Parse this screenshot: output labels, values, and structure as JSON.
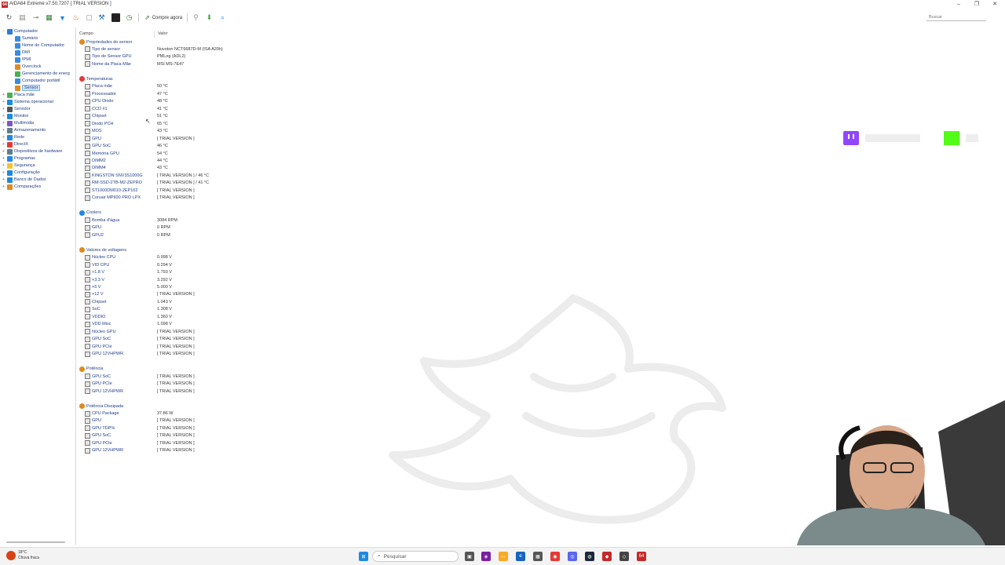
{
  "window": {
    "title": "AIDA64 Extreme v7.50.7207  [ TRIAL VERSION ]",
    "app_icon": "64"
  },
  "toolbar": {
    "buy_label": "Compre agora",
    "search_placeholder": "Buscar"
  },
  "sidebar": {
    "items": [
      {
        "label": "Computador",
        "color": "#2e7bd6"
      },
      {
        "label": "Sumário",
        "color": "#3a8be0"
      },
      {
        "label": "Nome do Computador",
        "color": "#3a8be0"
      },
      {
        "label": "DMI",
        "color": "#3a8be0"
      },
      {
        "label": "IPMI",
        "color": "#3a8be0"
      },
      {
        "label": "Overclock",
        "color": "#e08a1e"
      },
      {
        "label": "Gerenciamento de energ",
        "color": "#4caf50"
      },
      {
        "label": "Computador portátil",
        "color": "#3a8be0"
      },
      {
        "label": "Sensor",
        "color": "#e08a1e"
      },
      {
        "label": "Placa mãe",
        "color": "#4caf50"
      },
      {
        "label": "Sistema operacional",
        "color": "#1e88e5"
      },
      {
        "label": "Servidor",
        "color": "#555555"
      },
      {
        "label": "Monitor",
        "color": "#1e88e5"
      },
      {
        "label": "Multimídia",
        "color": "#7e57c2"
      },
      {
        "label": "Armazenamento",
        "color": "#607d8b"
      },
      {
        "label": "Rede",
        "color": "#1e88e5"
      },
      {
        "label": "DirectX",
        "color": "#e53935"
      },
      {
        "label": "Dispositivos de hardware",
        "color": "#607d8b"
      },
      {
        "label": "Programas",
        "color": "#1e88e5"
      },
      {
        "label": "Segurança",
        "color": "#fbc02d"
      },
      {
        "label": "Configuração",
        "color": "#1e88e5"
      },
      {
        "label": "Banco de Dados",
        "color": "#1e88e5"
      },
      {
        "label": "Comparações",
        "color": "#e08a1e"
      }
    ]
  },
  "main": {
    "col_field": "Campo",
    "col_value": "Valor",
    "rows": [
      {
        "type": "section",
        "label": "Propriedades do sensor",
        "color": "#e08a1e"
      },
      {
        "type": "row",
        "field": "Tipo de sensor",
        "value": "Nuvoton NCT6687D-M  (ISA A20h)"
      },
      {
        "type": "row",
        "field": "Tipo de Sensor GPU",
        "value": "PMLog  (ADL2)"
      },
      {
        "type": "row",
        "field": "Nome da Placa Mãe",
        "value": "MSI MS-7E47"
      },
      {
        "type": "gap"
      },
      {
        "type": "section",
        "label": "Temperaturas",
        "color": "#e53935"
      },
      {
        "type": "row",
        "field": "Placa mãe",
        "value": "50 °C"
      },
      {
        "type": "row",
        "field": "Processador",
        "value": "47 °C"
      },
      {
        "type": "row",
        "field": "CPU Diodo",
        "value": "48 °C"
      },
      {
        "type": "row",
        "field": "CCD #1",
        "value": "41 °C"
      },
      {
        "type": "row",
        "field": "Chipset",
        "value": "51 °C"
      },
      {
        "type": "row",
        "field": "Diodo PCH",
        "value": "65 °C"
      },
      {
        "type": "row",
        "field": "MOS",
        "value": "43 °C"
      },
      {
        "type": "row",
        "field": "GPU",
        "value": "[ TRIAL VERSION ]"
      },
      {
        "type": "row",
        "field": "GPU SoC",
        "value": "46 °C"
      },
      {
        "type": "row",
        "field": "Memória GPU",
        "value": "54 °C"
      },
      {
        "type": "row",
        "field": "DIMM2",
        "value": "44 °C"
      },
      {
        "type": "row",
        "field": "DIMM4",
        "value": "43 °C"
      },
      {
        "type": "row",
        "field": "KINGSTON SNV3S1000G",
        "value": "[ TRIAL VERSION ] / 46 °C"
      },
      {
        "type": "row",
        "field": "RM-SSD-2TB-M2-ZEPRO",
        "value": "[ TRIAL VERSION ] / 41 °C"
      },
      {
        "type": "row",
        "field": "ST1000DM010-2EP102",
        "value": "[ TRIAL VERSION ]"
      },
      {
        "type": "row",
        "field": "Corsair MP600 PRO LPX",
        "value": "[ TRIAL VERSION ]"
      },
      {
        "type": "gap"
      },
      {
        "type": "section",
        "label": "Coolers",
        "color": "#1e88e5"
      },
      {
        "type": "row",
        "field": "Bomba d'água",
        "value": "3084 RPM"
      },
      {
        "type": "row",
        "field": "GPU",
        "value": "0 RPM"
      },
      {
        "type": "row",
        "field": "GPU2",
        "value": "0 RPM"
      },
      {
        "type": "gap"
      },
      {
        "type": "section",
        "label": "Valores de voltagens",
        "color": "#e08a1e"
      },
      {
        "type": "row",
        "field": "Núcleo CPU",
        "value": "0.998 V"
      },
      {
        "type": "row",
        "field": "VID CPU",
        "value": "0.294 V"
      },
      {
        "type": "row",
        "field": "+1.8 V",
        "value": "1.793 V"
      },
      {
        "type": "row",
        "field": "+3.3 V",
        "value": "3.292 V"
      },
      {
        "type": "row",
        "field": "+5 V",
        "value": "5.000 V"
      },
      {
        "type": "row",
        "field": "+12 V",
        "value": "[ TRIAL VERSION ]"
      },
      {
        "type": "row",
        "field": "Chipset",
        "value": "1.043 V"
      },
      {
        "type": "row",
        "field": "SoC",
        "value": "1.308 V"
      },
      {
        "type": "row",
        "field": "VDDIO",
        "value": "1.360 V"
      },
      {
        "type": "row",
        "field": "VDD Misc",
        "value": "1.098 V"
      },
      {
        "type": "row",
        "field": "Núcleo GPU",
        "value": "[ TRIAL VERSION ]"
      },
      {
        "type": "row",
        "field": "GPU SoC",
        "value": "[ TRIAL VERSION ]"
      },
      {
        "type": "row",
        "field": "GPU PCIe",
        "value": "[ TRIAL VERSION ]"
      },
      {
        "type": "row",
        "field": "GPU 12VHPWR",
        "value": "[ TRIAL VERSION ]"
      },
      {
        "type": "gap"
      },
      {
        "type": "section",
        "label": "Potência",
        "color": "#e08a1e"
      },
      {
        "type": "row",
        "field": "GPU SoC",
        "value": "[ TRIAL VERSION ]"
      },
      {
        "type": "row",
        "field": "GPU PCIe",
        "value": "[ TRIAL VERSION ]"
      },
      {
        "type": "row",
        "field": "GPU 12VHPWR",
        "value": "[ TRIAL VERSION ]"
      },
      {
        "type": "gap"
      },
      {
        "type": "section",
        "label": "Potência Dissipada",
        "color": "#e08a1e"
      },
      {
        "type": "row",
        "field": "CPU Package",
        "value": "37.86 W"
      },
      {
        "type": "row",
        "field": "GPU",
        "value": "[ TRIAL VERSION ]"
      },
      {
        "type": "row",
        "field": "GPU TDP%",
        "value": "[ TRIAL VERSION ]"
      },
      {
        "type": "row",
        "field": "GPU SoC",
        "value": "[ TRIAL VERSION ]"
      },
      {
        "type": "row",
        "field": "GPU PCIe",
        "value": "[ TRIAL VERSION ]"
      },
      {
        "type": "row",
        "field": "GPU 12VHPWR",
        "value": "[ TRIAL VERSION ]"
      }
    ]
  },
  "taskbar": {
    "weather_temp": "18°C",
    "weather_desc": "Chuva fraca",
    "search_label": "Pesquisar",
    "aida_label": "64",
    "accent": "#c62828"
  }
}
